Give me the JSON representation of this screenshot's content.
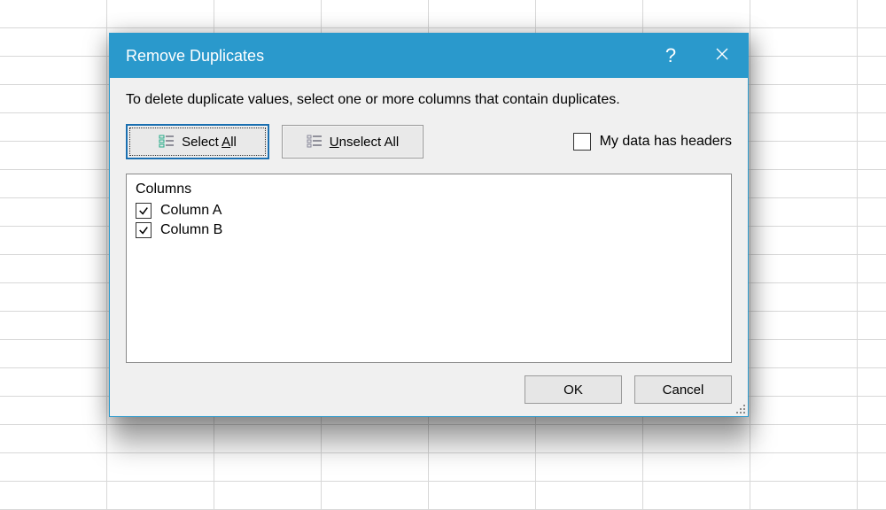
{
  "dialog": {
    "title": "Remove Duplicates",
    "instruction": "To delete duplicate values, select one or more columns that contain duplicates.",
    "select_all_prefix": "Select ",
    "select_all_accel": "A",
    "select_all_suffix": "ll",
    "unselect_all_accel": "U",
    "unselect_all_rest": "nselect All",
    "headers_accel": "M",
    "headers_rest": "y data has headers",
    "headers_checked": false,
    "list_header": "Columns",
    "columns": [
      {
        "label": "Column A",
        "checked": true
      },
      {
        "label": "Column B",
        "checked": true
      }
    ],
    "ok": "OK",
    "cancel": "Cancel"
  },
  "colors": {
    "accent": "#2a99cc"
  }
}
